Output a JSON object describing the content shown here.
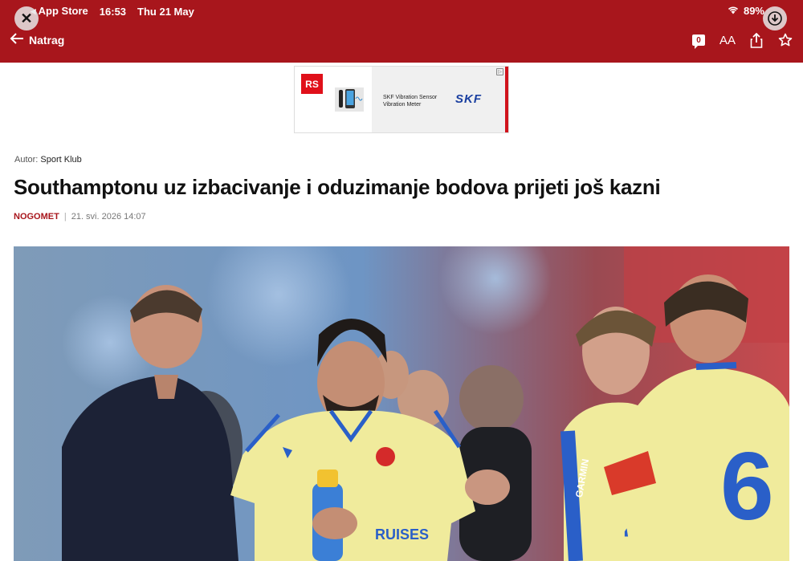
{
  "status": {
    "back_app": "◂ App Store",
    "time": "16:53",
    "date": "Thu 21 May",
    "battery": "89%"
  },
  "nav": {
    "back_label": "Natrag",
    "comment_count": "0",
    "text_size_label": "AA"
  },
  "ad": {
    "brand_logo": "RS",
    "product_text_line1": "SKF Vibration Sensor",
    "product_text_line2": "Vibration Meter",
    "advertiser": "SKF"
  },
  "article": {
    "author_prefix": "Autor:",
    "author": "Sport Klub",
    "headline": "Southamptonu uz izbacivanje i oduzimanje bodova prijeti još kazni",
    "category": "NOGOMET",
    "separator": "|",
    "date": "21. svi. 2026 14:07"
  },
  "hero": {
    "shirt_number": "6",
    "sponsor_text": "RUISES",
    "sleeve_text": "GARMIN"
  },
  "colors": {
    "brand_red": "#a8161c",
    "jersey_yellow": "#f2eea0",
    "jersey_blue": "#2a5fc8"
  }
}
